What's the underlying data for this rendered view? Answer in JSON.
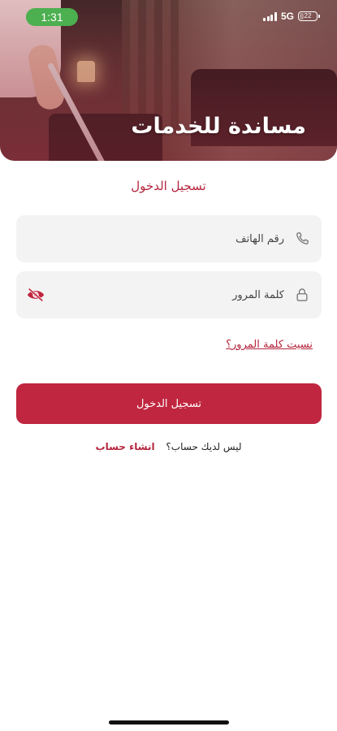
{
  "status_bar": {
    "time": "1:31",
    "network": "5G",
    "battery": "22",
    "battery_level": 0.22
  },
  "hero": {
    "title": "مساندة للخدمات"
  },
  "login": {
    "heading": "تسجيل الدخول",
    "phone": {
      "placeholder": "رقم الهاتف",
      "value": "",
      "icon": "phone-icon"
    },
    "password": {
      "placeholder": "كلمة المرور",
      "value": "",
      "icon": "lock-icon",
      "toggle_icon": "eye-slash-icon"
    },
    "forgot_password": "نسيت كلمة المرور؟",
    "submit_label": "تسجيل الدخول",
    "no_account_text": "ليس لديك حساب؟",
    "create_account_label": "انشاء حساب"
  },
  "colors": {
    "accent": "#c0263f",
    "field_bg": "#f3f3f3",
    "status_pill": "#4caf50"
  }
}
